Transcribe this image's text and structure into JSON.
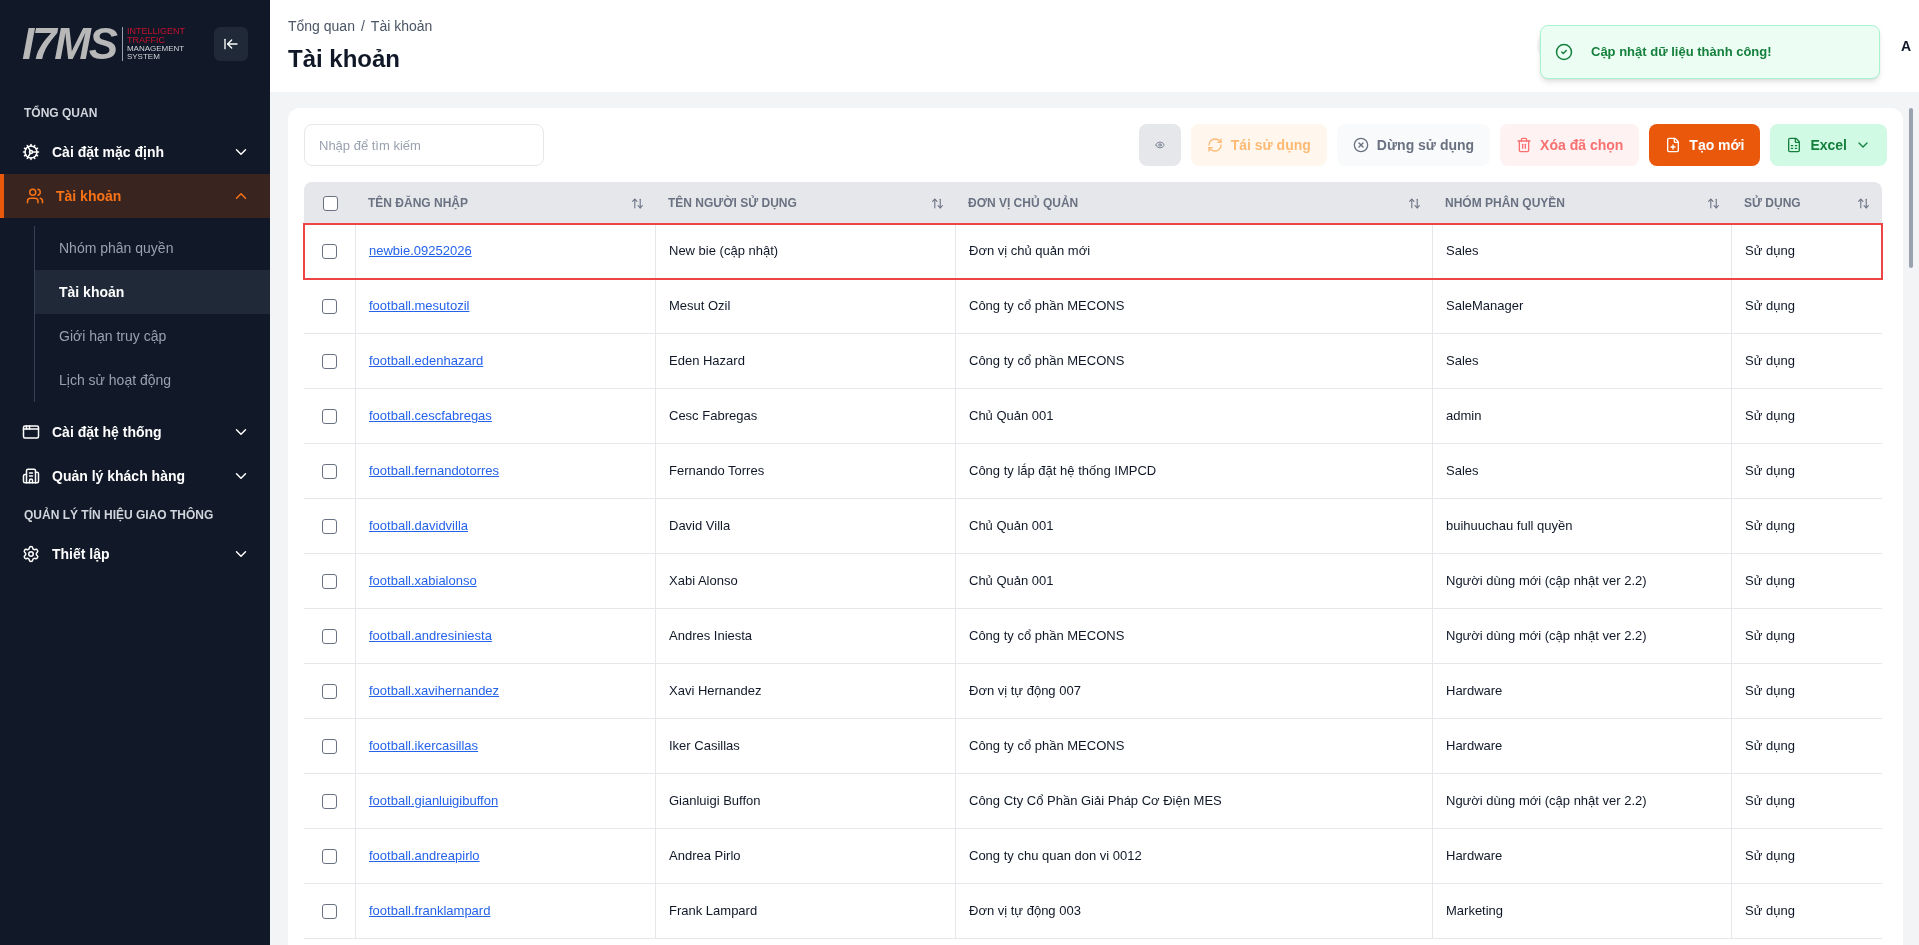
{
  "sidebar": {
    "logo": {
      "mark": "I7MS",
      "lines": [
        "INTELLIGENT",
        "TRAFFIC",
        "MANAGEMENT",
        "SYSTEM"
      ]
    },
    "sections": [
      {
        "kind": "heading",
        "label": "TỔNG QUAN"
      },
      {
        "kind": "item",
        "label": "Cài đặt mặc định",
        "expanded": false,
        "selected": false
      },
      {
        "kind": "item",
        "label": "Tài khoản",
        "expanded": true,
        "selected": true,
        "children": [
          {
            "label": "Nhóm phân quyền",
            "selected": false
          },
          {
            "label": "Tài khoản",
            "selected": true
          },
          {
            "label": "Giới hạn truy cập",
            "selected": false
          },
          {
            "label": "Lịch sử hoạt động",
            "selected": false
          }
        ]
      },
      {
        "kind": "item",
        "label": "Cài đặt hệ thống",
        "expanded": false,
        "selected": false
      },
      {
        "kind": "item",
        "label": "Quản lý khách hàng",
        "expanded": false,
        "selected": false
      },
      {
        "kind": "heading",
        "label": "QUẢN LÝ TÍN HIỆU GIAO THÔNG"
      },
      {
        "kind": "item",
        "label": "Thiết lập",
        "expanded": false,
        "selected": false
      }
    ]
  },
  "header": {
    "breadcrumb": [
      "Tổng quan",
      "/",
      "Tài khoản"
    ],
    "title": "Tài khoản",
    "avatar": "A"
  },
  "toast": {
    "message": "Cập nhật dữ liệu thành công!"
  },
  "toolbar": {
    "search": {
      "placeholder": "Nhập để tìm kiếm"
    },
    "buttons": [
      {
        "kind": "view"
      },
      {
        "kind": "restore",
        "label": "Tái sử dụng",
        "disabled": true
      },
      {
        "kind": "stop",
        "label": "Dừng sử dụng",
        "disabled": true
      },
      {
        "kind": "delete",
        "label": "Xóa đã chọn",
        "disabled": true
      },
      {
        "kind": "create",
        "label": "Tạo mới",
        "disabled": false
      },
      {
        "kind": "excel",
        "label": "Excel",
        "disabled": false
      }
    ]
  },
  "table": {
    "all_checked": false,
    "columns": [
      "TÊN ĐĂNG NHẬP",
      "TÊN NGƯỜI SỬ DỤNG",
      "ĐƠN VỊ CHỦ QUẢN",
      "NHÓM PHÂN QUYỀN",
      "SỬ DỤNG"
    ],
    "rows": [
      {
        "checked": false,
        "highlighted": true,
        "cells": [
          "newbie.09252026",
          "New bie (cập nhật)",
          "Đơn vị chủ quản mới",
          "Sales",
          "Sử dụng"
        ]
      },
      {
        "checked": false,
        "highlighted": false,
        "cells": [
          "football.mesutozil",
          "Mesut Ozil",
          "Công ty cổ phần MECONS",
          "SaleManager",
          "Sử dụng"
        ]
      },
      {
        "checked": false,
        "highlighted": false,
        "cells": [
          "football.edenhazard",
          "Eden Hazard",
          "Công ty cổ phần MECONS",
          "Sales",
          "Sử dụng"
        ]
      },
      {
        "checked": false,
        "highlighted": false,
        "cells": [
          "football.cescfabregas",
          "Cesc Fabregas",
          "Chủ Quản 001",
          "admin",
          "Sử dụng"
        ]
      },
      {
        "checked": false,
        "highlighted": false,
        "cells": [
          "football.fernandotorres",
          "Fernando Torres",
          "Công ty lắp đặt hệ thống IMPCD",
          "Sales",
          "Sử dụng"
        ]
      },
      {
        "checked": false,
        "highlighted": false,
        "cells": [
          "football.davidvilla",
          "David Villa",
          "Chủ Quản 001",
          "buihuuchau full quyền",
          "Sử dụng"
        ]
      },
      {
        "checked": false,
        "highlighted": false,
        "cells": [
          "football.xabialonso",
          "Xabi Alonso",
          "Chủ Quản 001",
          "Người dùng mới (cập nhật ver 2.2)",
          "Sử dụng"
        ]
      },
      {
        "checked": false,
        "highlighted": false,
        "cells": [
          "football.andresiniesta",
          "Andres Iniesta",
          "Công ty cổ phần MECONS",
          "Người dùng mới (cập nhật ver 2.2)",
          "Sử dụng"
        ]
      },
      {
        "checked": false,
        "highlighted": false,
        "cells": [
          "football.xavihernandez",
          "Xavi Hernandez",
          "Đơn vị tự động 007",
          "Hardware",
          "Sử dụng"
        ]
      },
      {
        "checked": false,
        "highlighted": false,
        "cells": [
          "football.ikercasillas",
          "Iker Casillas",
          "Công ty cổ phần MECONS",
          "Hardware",
          "Sử dụng"
        ]
      },
      {
        "checked": false,
        "highlighted": false,
        "cells": [
          "football.gianluigibuffon",
          "Gianluigi Buffon",
          "Công Cty Cổ Phần Giải Pháp Cơ Điện MES",
          "Người dùng mới (cập nhật ver 2.2)",
          "Sử dụng"
        ]
      },
      {
        "checked": false,
        "highlighted": false,
        "cells": [
          "football.andreapirlo",
          "Andrea Pirlo",
          "Cong ty chu quan don vi 0012",
          "Hardware",
          "Sử dụng"
        ]
      },
      {
        "checked": false,
        "highlighted": false,
        "cells": [
          "football.franklampard",
          "Frank Lampard",
          "Đơn vị tự động 003",
          "Marketing",
          "Sử dụng"
        ]
      }
    ]
  }
}
